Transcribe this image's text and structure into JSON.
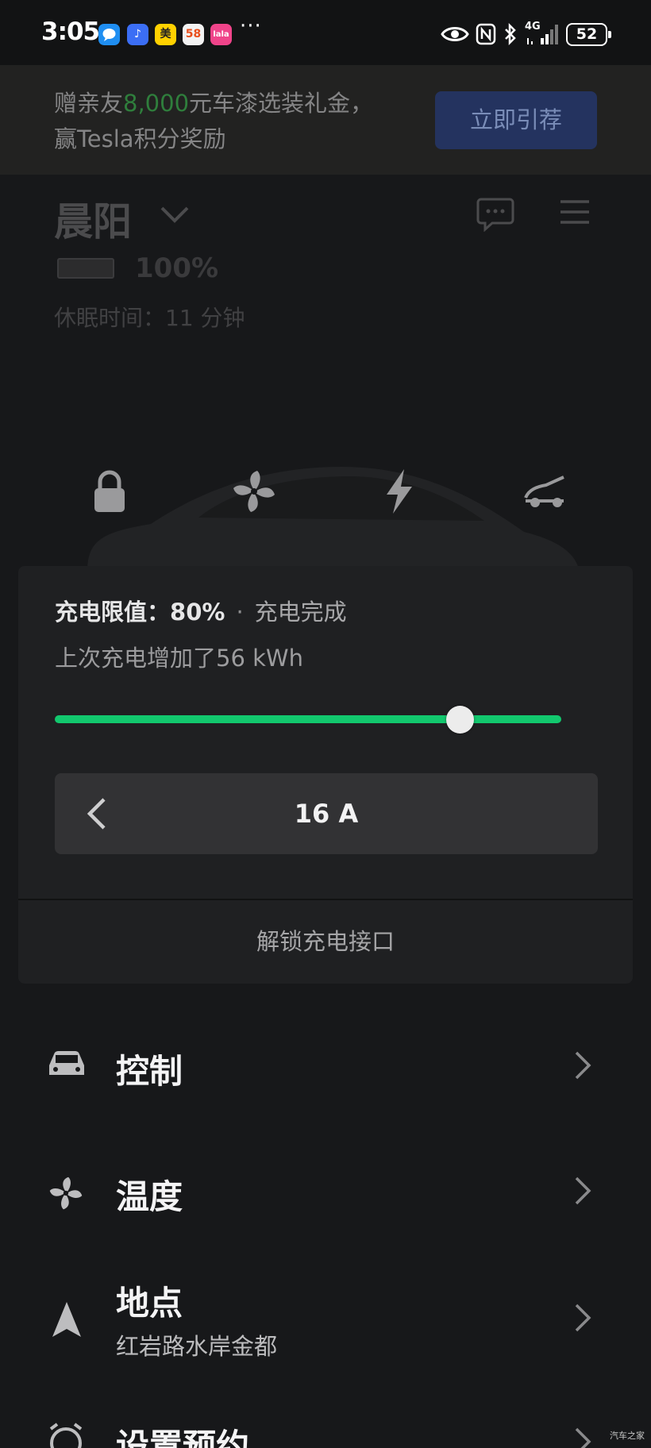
{
  "status_bar": {
    "time": "3:05",
    "more": "···",
    "app_icons": [
      {
        "name": "message-app-icon",
        "label": "",
        "color": "#1f8ef1"
      },
      {
        "name": "music-app-icon",
        "label": "♪",
        "color": "#3b6ef5"
      },
      {
        "name": "meituan-app-icon",
        "label": "美",
        "color": "#ffd100"
      },
      {
        "name": "58-app-icon",
        "label": "58",
        "color": "#f2f2f2"
      },
      {
        "name": "lala-app-icon",
        "label": "lala",
        "color": "#f0448a"
      }
    ],
    "network": "4G",
    "battery": "52"
  },
  "banner": {
    "text_prefix": "赠亲友",
    "text_highlight": "8,000",
    "text_suffix": "元车漆选装礼金，",
    "text_line2": "赢Tesla积分奖励",
    "button_label": "立即引荐",
    "highlight_color": "#2f7e3c",
    "button_color": "#24335f"
  },
  "vehicle": {
    "name": "晨阳",
    "battery_percent": "100%",
    "sleep_label": "休眠时间：11 分钟"
  },
  "quick_controls": [
    {
      "name": "lock-icon"
    },
    {
      "name": "fan-icon"
    },
    {
      "name": "charge-bolt-icon"
    },
    {
      "name": "frunk-icon"
    }
  ],
  "charging": {
    "limit_label": "充电限值：",
    "limit_value": "80%",
    "separator": "·",
    "status": "充电完成",
    "added_text": "上次充电增加了56 kWh",
    "limit_fraction": 0.8,
    "amperage": "16 A",
    "unlock_port_label": "解锁充电接口",
    "accent_color": "#12c86e"
  },
  "menu": {
    "controls_label": "控制",
    "climate_label": "温度",
    "location_label": "地点",
    "location_address": "红岩路水岸金都",
    "schedule_label": "设置预约"
  },
  "watermark": "汽车之家"
}
